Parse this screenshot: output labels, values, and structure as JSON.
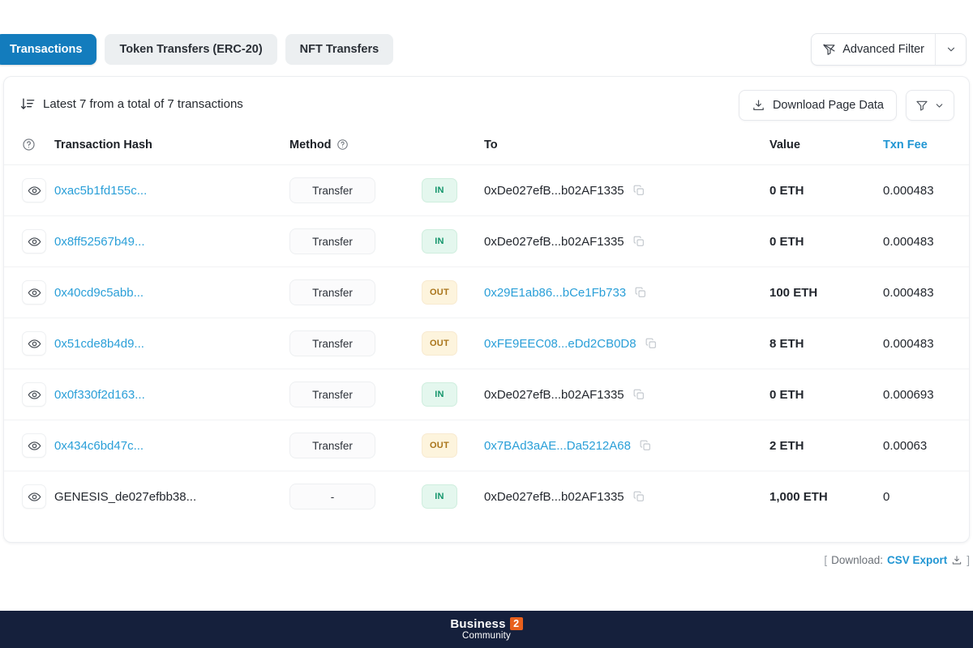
{
  "tabs": [
    {
      "label": "Transactions",
      "active": true
    },
    {
      "label": "Token Transfers (ERC-20)",
      "active": false
    },
    {
      "label": "NFT Transfers",
      "active": false
    }
  ],
  "advanced_filter": {
    "label": "Advanced Filter",
    "icon": "filter-off-icon",
    "caret_icon": "chevron-down-icon"
  },
  "toolbar": {
    "sort_icon": "sort-descending-icon",
    "summary": "Latest 7 from a total of 7 transactions",
    "download_label": "Download Page Data",
    "download_icon": "download-icon",
    "filter_icon": "funnel-icon",
    "filter_caret_icon": "chevron-down-icon"
  },
  "table": {
    "headers": {
      "eye": "",
      "eye_icon": "question-circle-icon",
      "hash": "Transaction Hash",
      "method": "Method",
      "method_info_icon": "question-circle-icon",
      "direction": "",
      "to": "To",
      "value": "Value",
      "fee": "Txn Fee"
    },
    "rows": [
      {
        "eye_icon": "eye-icon",
        "hash": "0xac5b1fd155c...",
        "hash_is_link": true,
        "method": "Transfer",
        "direction": "IN",
        "to": "0xDe027efB...b02AF1335",
        "to_is_link": false,
        "copy_icon": "copy-icon",
        "value": "0 ETH",
        "fee": "0.000483"
      },
      {
        "eye_icon": "eye-icon",
        "hash": "0x8ff52567b49...",
        "hash_is_link": true,
        "method": "Transfer",
        "direction": "IN",
        "to": "0xDe027efB...b02AF1335",
        "to_is_link": false,
        "copy_icon": "copy-icon",
        "value": "0 ETH",
        "fee": "0.000483"
      },
      {
        "eye_icon": "eye-icon",
        "hash": "0x40cd9c5abb...",
        "hash_is_link": true,
        "method": "Transfer",
        "direction": "OUT",
        "to": "0x29E1ab86...bCe1Fb733",
        "to_is_link": true,
        "copy_icon": "copy-icon",
        "value": "100 ETH",
        "fee": "0.000483"
      },
      {
        "eye_icon": "eye-icon",
        "hash": "0x51cde8b4d9...",
        "hash_is_link": true,
        "method": "Transfer",
        "direction": "OUT",
        "to": "0xFE9EEC08...eDd2CB0D8",
        "to_is_link": true,
        "copy_icon": "copy-icon",
        "value": "8 ETH",
        "fee": "0.000483"
      },
      {
        "eye_icon": "eye-icon",
        "hash": "0x0f330f2d163...",
        "hash_is_link": true,
        "method": "Transfer",
        "direction": "IN",
        "to": "0xDe027efB...b02AF1335",
        "to_is_link": false,
        "copy_icon": "copy-icon",
        "value": "0 ETH",
        "fee": "0.000693"
      },
      {
        "eye_icon": "eye-icon",
        "hash": "0x434c6bd47c...",
        "hash_is_link": true,
        "method": "Transfer",
        "direction": "OUT",
        "to": "0x7BAd3aAE...Da5212A68",
        "to_is_link": true,
        "copy_icon": "copy-icon",
        "value": "2 ETH",
        "fee": "0.00063"
      },
      {
        "eye_icon": "eye-icon",
        "hash": "GENESIS_de027efbb38...",
        "hash_is_link": false,
        "method": "-",
        "direction": "IN",
        "to": "0xDe027efB...b02AF1335",
        "to_is_link": false,
        "copy_icon": "copy-icon",
        "value": "1,000 ETH",
        "fee": "0"
      }
    ]
  },
  "footer": {
    "bracket_open": "[",
    "download_prefix": "Download:",
    "csv_label": "CSV Export",
    "csv_icon": "download-icon",
    "bracket_close": "]"
  },
  "banner": {
    "logo_word": "Business",
    "logo_two": "2",
    "logo_sub": "Community"
  },
  "colors": {
    "tab_active_bg": "#137cbd",
    "link": "#2a9fd8",
    "in_badge_bg": "#e4f7ee",
    "in_badge_text": "#13956b",
    "out_badge_bg": "#fdf4dd",
    "out_badge_text": "#a9741a",
    "banner_bg": "#15203c",
    "logo_accent": "#e8601c"
  }
}
